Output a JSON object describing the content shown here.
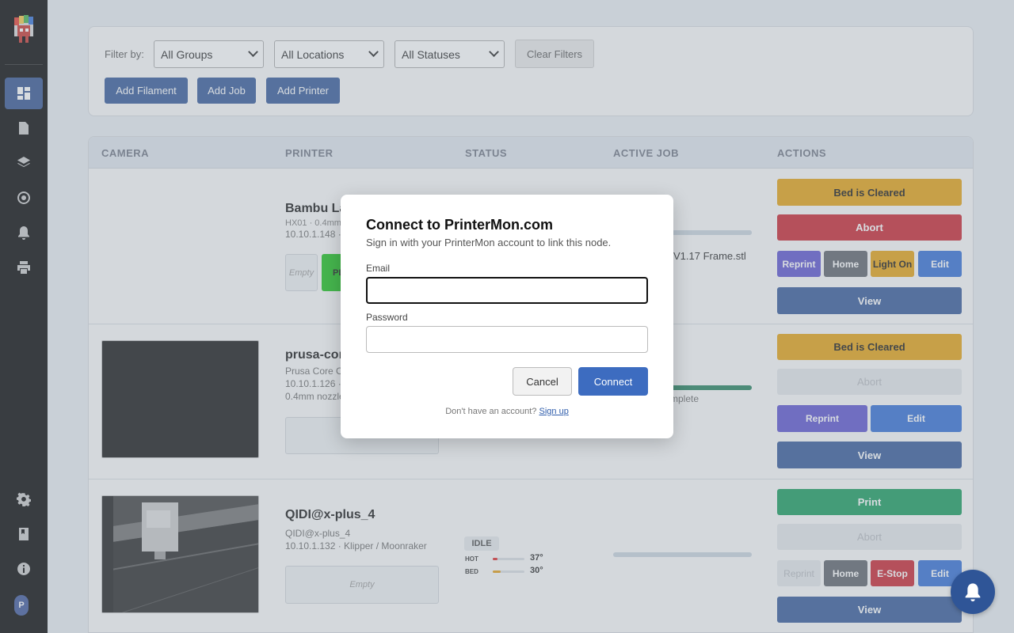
{
  "filters": {
    "label": "Filter by:",
    "groups": "All Groups",
    "locations": "All Locations",
    "statuses": "All Statuses",
    "clear": "Clear Filters"
  },
  "toolbar": {
    "add_filament": "Add Filament",
    "add_job": "Add Job",
    "add_printer": "Add Printer"
  },
  "table": {
    "headers": [
      "CAMERA",
      "PRINTER",
      "STATUS",
      "ACTIVE JOB",
      "ACTIONS"
    ]
  },
  "printers": [
    {
      "name": "Bambu La",
      "model": "HX01 · 0.4mm",
      "address": "10.10.1.148 ·",
      "slot_empty": "Empty",
      "slot_label": "PL",
      "job_file": "V1.17 Frame.stl",
      "progress": 1.0,
      "actions": {
        "bed_cleared": "Bed is Cleared",
        "abort": "Abort",
        "reprint": "Reprint",
        "home": "Home",
        "light": "Light On",
        "edit": "Edit",
        "view": "View"
      }
    },
    {
      "name": "prusa-cor",
      "model": "Prusa Core O",
      "address": "10.10.1.126 ·",
      "nozzle": "0.4mm nozzle",
      "job_status": "mplete",
      "progress": 1.0,
      "actions": {
        "bed_cleared": "Bed is Cleared",
        "abort": "Abort",
        "reprint": "Reprint",
        "edit": "Edit",
        "view": "View"
      }
    },
    {
      "name": "QIDI@x-plus_4",
      "model": "QIDI@x-plus_4",
      "address": "10.10.1.132 · Klipper / Moonraker",
      "slot_empty": "Empty",
      "status": "IDLE",
      "hot_label": "HOT",
      "hot_temp": "37°",
      "bed_label": "BED",
      "bed_temp": "30°",
      "progress": 0,
      "actions": {
        "print": "Print",
        "abort": "Abort",
        "reprint": "Reprint",
        "home": "Home",
        "estop": "E-Stop",
        "edit": "Edit",
        "view": "View"
      }
    }
  ],
  "modal": {
    "title": "Connect to PrinterMon.com",
    "subtitle": "Sign in with your PrinterMon account to link this node.",
    "email_label": "Email",
    "email_value": "",
    "password_label": "Password",
    "password_value": "",
    "cancel": "Cancel",
    "connect": "Connect",
    "signup_prompt": "Don't have an account?",
    "signup_link": "Sign up"
  },
  "sidebar": {
    "avatar_initial": "P",
    "items": [
      "dashboard-icon",
      "document-icon",
      "layers-icon",
      "target-icon",
      "bell-icon",
      "printer-icon"
    ],
    "bottom_items": [
      "gear-icon",
      "book-icon",
      "info-icon"
    ]
  }
}
